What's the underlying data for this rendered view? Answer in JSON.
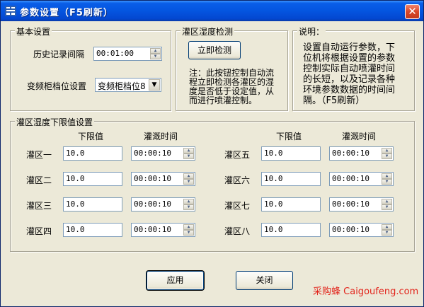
{
  "window": {
    "title": "参数设置（F5刷新）",
    "close_label": "✕"
  },
  "basic": {
    "group_label": "基本设置",
    "history_label": "历史记录间隔",
    "history_value": "00:01:00",
    "fan_label": "变频柜档位设置",
    "fan_value": "变频柜档位8"
  },
  "detect": {
    "group_label": "灌区湿度检测",
    "button_label": "立即检测",
    "note_lines": [
      "注：此按钮控制自动流",
      "程立即检测各灌区的湿",
      "度是否低于设定值，从",
      "而进行喷灌控制。"
    ]
  },
  "explain": {
    "group_label": "说明：",
    "text_lines": [
      "设置自动运行参数，下",
      "位机将根据设置的参数",
      "控制实际自动喷灌时间",
      "的长短，以及记录各种",
      "环境参数数据的时间间",
      "隔。（F5刷新）"
    ]
  },
  "limits": {
    "group_label": "灌区湿度下限值设置",
    "col_lower": "下限值",
    "col_time": "灌溉时间",
    "zones": [
      {
        "name": "灌区一",
        "lower": "10.0",
        "time": "00:00:10"
      },
      {
        "name": "灌区二",
        "lower": "10.0",
        "time": "00:00:10"
      },
      {
        "name": "灌区三",
        "lower": "10.0",
        "time": "00:00:10"
      },
      {
        "name": "灌区四",
        "lower": "10.0",
        "time": "00:00:10"
      },
      {
        "name": "灌区五",
        "lower": "10.0",
        "time": "00:00:10"
      },
      {
        "name": "灌区六",
        "lower": "10.0",
        "time": "00:00:10"
      },
      {
        "name": "灌区七",
        "lower": "10.0",
        "time": "00:00:10"
      },
      {
        "name": "灌区八",
        "lower": "10.0",
        "time": "00:00:10"
      }
    ]
  },
  "footer": {
    "apply_label": "应用",
    "close_label": "关闭",
    "watermark_cn": "采购蜂",
    "watermark_en": "Caigoufeng.com"
  },
  "colors": {
    "titlebar": "#0455e0",
    "face": "#ece9d8",
    "watermark": "#e2231a"
  },
  "icons": {
    "title": "app-icon",
    "close": "close-icon",
    "spin": "spin-arrows-icon",
    "dropdown": "chevron-down-icon"
  }
}
